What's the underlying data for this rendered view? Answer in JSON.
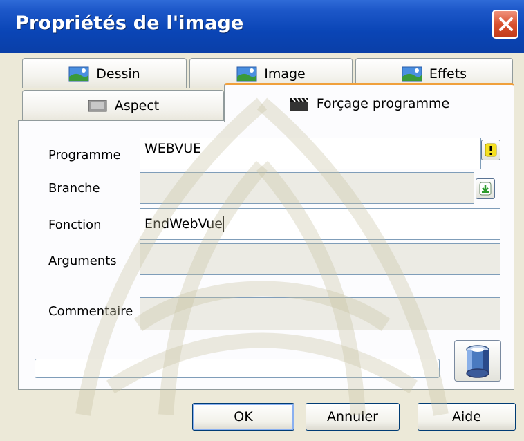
{
  "window": {
    "title": "Propriétés de l'image"
  },
  "tabs_row1": [
    {
      "label": "Dessin",
      "icon": "landscape-icon"
    },
    {
      "label": "Image",
      "icon": "landscape-icon"
    },
    {
      "label": "Effets",
      "icon": "landscape-icon"
    }
  ],
  "tabs_row2": [
    {
      "label": "Aspect",
      "icon": "frame-icon"
    },
    {
      "label": "Forçage programme",
      "icon": "clapperboard-icon",
      "active": true
    }
  ],
  "form": {
    "programme_label": "Programme",
    "programme_value": "WEBVUE",
    "branche_label": "Branche",
    "branche_value": "",
    "fonction_label": "Fonction",
    "fonction_value": "EndWebVue",
    "arguments_label": "Arguments",
    "arguments_value": "",
    "commentaire_label": "Commentaire",
    "commentaire_value": ""
  },
  "progress": {
    "value": 0.0
  },
  "buttons": {
    "ok": "OK",
    "cancel": "Annuler",
    "help": "Aide"
  },
  "colors": {
    "titlebar": "#0a45b6",
    "active_tab_accent": "#f0a03c",
    "close": "#d8512f",
    "field_border": "#7f9db9",
    "dialog_bg": "#ece9d8"
  }
}
